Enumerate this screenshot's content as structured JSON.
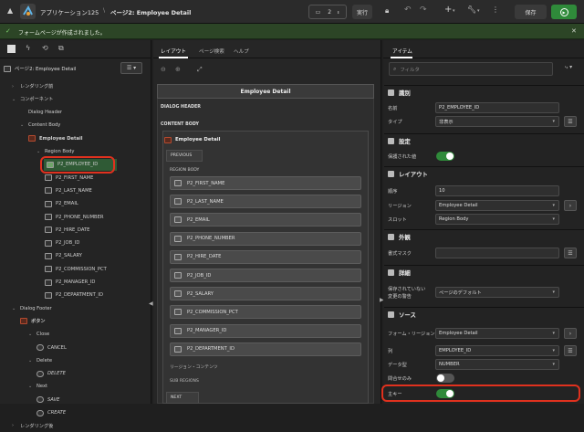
{
  "header": {
    "app_title": "アプリケーション125",
    "page_title": "ページ2: Employee Detail",
    "page_number": "2",
    "run_label": "実行",
    "save_label": "保存"
  },
  "success_message": "フォームページが作成されました。",
  "left_panel": {
    "page_select": "ページ2: Employee Detail",
    "tree": [
      {
        "label": "レンダリング前",
        "level": 0,
        "icon": "chevron-right",
        "indent": 1
      },
      {
        "label": "コンポーネント",
        "level": 0,
        "icon": "chevron-down",
        "indent": 1
      },
      {
        "label": "Dialog Header",
        "level": 1,
        "icon": "none",
        "indent": 2
      },
      {
        "label": "Content Body",
        "level": 1,
        "icon": "chevron-down",
        "indent": 2
      },
      {
        "label": "Employee Detail",
        "level": 2,
        "icon": "region-red",
        "indent": 3
      },
      {
        "label": "Region Body",
        "level": 3,
        "icon": "chevron-down",
        "indent": 4
      },
      {
        "label": "P2_EMPLOYEE_ID",
        "level": 4,
        "icon": "item",
        "indent": 5,
        "selected": true
      },
      {
        "label": "P2_FIRST_NAME",
        "level": 4,
        "icon": "item",
        "indent": 5
      },
      {
        "label": "P2_LAST_NAME",
        "level": 4,
        "icon": "item",
        "indent": 5
      },
      {
        "label": "P2_EMAIL",
        "level": 4,
        "icon": "item",
        "indent": 5
      },
      {
        "label": "P2_PHONE_NUMBER",
        "level": 4,
        "icon": "item",
        "indent": 5
      },
      {
        "label": "P2_HIRE_DATE",
        "level": 4,
        "icon": "item",
        "indent": 5
      },
      {
        "label": "P2_JOB_ID",
        "level": 4,
        "icon": "item",
        "indent": 5
      },
      {
        "label": "P2_SALARY",
        "level": 4,
        "icon": "item",
        "indent": 5
      },
      {
        "label": "P2_COMMISSION_PCT",
        "level": 4,
        "icon": "item",
        "indent": 5
      },
      {
        "label": "P2_MANAGER_ID",
        "level": 4,
        "icon": "item",
        "indent": 5
      },
      {
        "label": "P2_DEPARTMENT_ID",
        "level": 4,
        "icon": "item",
        "indent": 5
      },
      {
        "label": "Dialog Footer",
        "level": 1,
        "icon": "chevron-down",
        "indent": 1
      },
      {
        "label": "ボタン",
        "level": 2,
        "icon": "button-red",
        "indent": 2
      },
      {
        "label": "Close",
        "level": 3,
        "icon": "chevron-down",
        "indent": 3
      },
      {
        "label": "CANCEL",
        "level": 4,
        "icon": "button",
        "indent": 4
      },
      {
        "label": "Delete",
        "level": 3,
        "icon": "chevron-down",
        "indent": 3
      },
      {
        "label": "DELETE",
        "level": 4,
        "icon": "button",
        "indent": 4,
        "italic": true
      },
      {
        "label": "Next",
        "level": 3,
        "icon": "chevron-down",
        "indent": 3
      },
      {
        "label": "SAVE",
        "level": 4,
        "icon": "button",
        "indent": 4,
        "italic": true
      },
      {
        "label": "CREATE",
        "level": 4,
        "icon": "button",
        "indent": 4,
        "italic": true
      },
      {
        "label": "レンダリング後",
        "level": 0,
        "icon": "chevron-right",
        "indent": 1
      }
    ]
  },
  "mid_panel": {
    "tabs": [
      "レイアウト",
      "ページ検索",
      "ヘルプ"
    ],
    "region_title": "Employee Detail",
    "dialog_header_label": "DIALOG HEADER",
    "content_body_label": "CONTENT BODY",
    "inner_region_title": "Employee Detail",
    "previous_label": "PREVIOUS",
    "region_body_label": "REGION BODY",
    "items": [
      "P2_FIRST_NAME",
      "P2_LAST_NAME",
      "P2_EMAIL",
      "P2_PHONE_NUMBER",
      "P2_HIRE_DATE",
      "P2_JOB_ID",
      "P2_SALARY",
      "P2_COMMISSION_PCT",
      "P2_MANAGER_ID",
      "P2_DEPARTMENT_ID"
    ],
    "region_content_label": "リージョン・コンテンツ",
    "sub_regions_label": "SUB REGIONS",
    "next_label": "NEXT"
  },
  "right_panel": {
    "tab": "アイテム",
    "filter_placeholder": "フィルタ",
    "sections": {
      "identification": "識別",
      "settings": "設定",
      "layout": "レイアウト",
      "appearance": "外観",
      "advanced": "詳細",
      "source": "ソース"
    },
    "props": {
      "name_label": "名前",
      "name_value": "P2_EMPLOYEE_ID",
      "type_label": "タイプ",
      "type_value": "非表示",
      "protected_label": "保護された値",
      "protected_on": true,
      "sequence_label": "順序",
      "sequence_value": "10",
      "region_label": "リージョン",
      "region_value": "Employee Detail",
      "slot_label": "スロット",
      "slot_value": "Region Body",
      "format_mask_label": "書式マスク",
      "format_mask_value": "",
      "warn_label_1": "保存されていない",
      "warn_label_2": "変更の警告",
      "warn_value": "ページのデフォルト",
      "form_region_label": "フォーム・リージョン",
      "form_region_value": "Employee Detail",
      "column_label": "列",
      "column_value": "EMPLOYEE_ID",
      "datatype_label": "データ型",
      "datatype_value": "NUMBER",
      "query_only_label": "問合せのみ",
      "query_only_on": false,
      "primary_key_label": "主キー",
      "primary_key_on": true
    }
  },
  "colors": {
    "accent_green": "#2f8a3a",
    "success_bg": "#2c4526",
    "highlight_red": "#e0311e"
  }
}
